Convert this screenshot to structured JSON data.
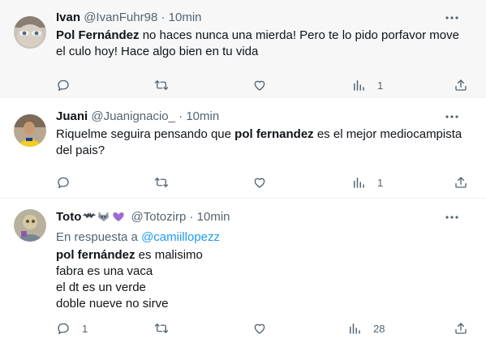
{
  "tweets": [
    {
      "name": "Ivan",
      "handle": "@IvanFuhr98",
      "time": "10min",
      "reply_prefix": "",
      "reply_link": "",
      "lines": [
        {
          "bold": "Pol Fernández",
          "text": " no haces nunca una mierda! Pero te lo pido porfavor move"
        },
        {
          "bold": "",
          "text": "el culo hoy! Hace algo bien en tu vida"
        }
      ],
      "replies": "",
      "retweets": "",
      "likes": "",
      "views": "1"
    },
    {
      "name": "Juani",
      "handle": "@Juanignacio_",
      "time": "10min",
      "reply_prefix": "",
      "reply_link": "",
      "lines": [
        {
          "pre": "Riquelme seguira pensando que ",
          "bold": "pol fernandez",
          "text": " es el mejor mediocampista"
        },
        {
          "bold": "",
          "text": "del pais?"
        }
      ],
      "replies": "",
      "retweets": "",
      "likes": "",
      "views": "1"
    },
    {
      "name": "Toto",
      "name_emoji": [
        "bat",
        "wolf",
        "purple-heart"
      ],
      "handle": "@Totozirp",
      "time": "10min",
      "reply_prefix": "En respuesta a ",
      "reply_link": "@camiillopezz",
      "lines": [
        {
          "bold": "pol fernández",
          "text": " es malisimo"
        },
        {
          "bold": "",
          "text": "fabra es una vaca"
        },
        {
          "bold": "",
          "text": "el dt es un verde"
        },
        {
          "bold": "",
          "text": "doble nueve no sirve"
        }
      ],
      "replies": "1",
      "retweets": "",
      "likes": "",
      "views": "28"
    }
  ],
  "separator": "·",
  "icons": [
    "more-icon",
    "reply-icon",
    "retweet-icon",
    "like-icon",
    "views-icon",
    "share-icon"
  ],
  "colors": {
    "text": "#0f1419",
    "muted": "#536471",
    "link": "#1d9bf0",
    "highlight_bg": "#f7f7f7"
  }
}
